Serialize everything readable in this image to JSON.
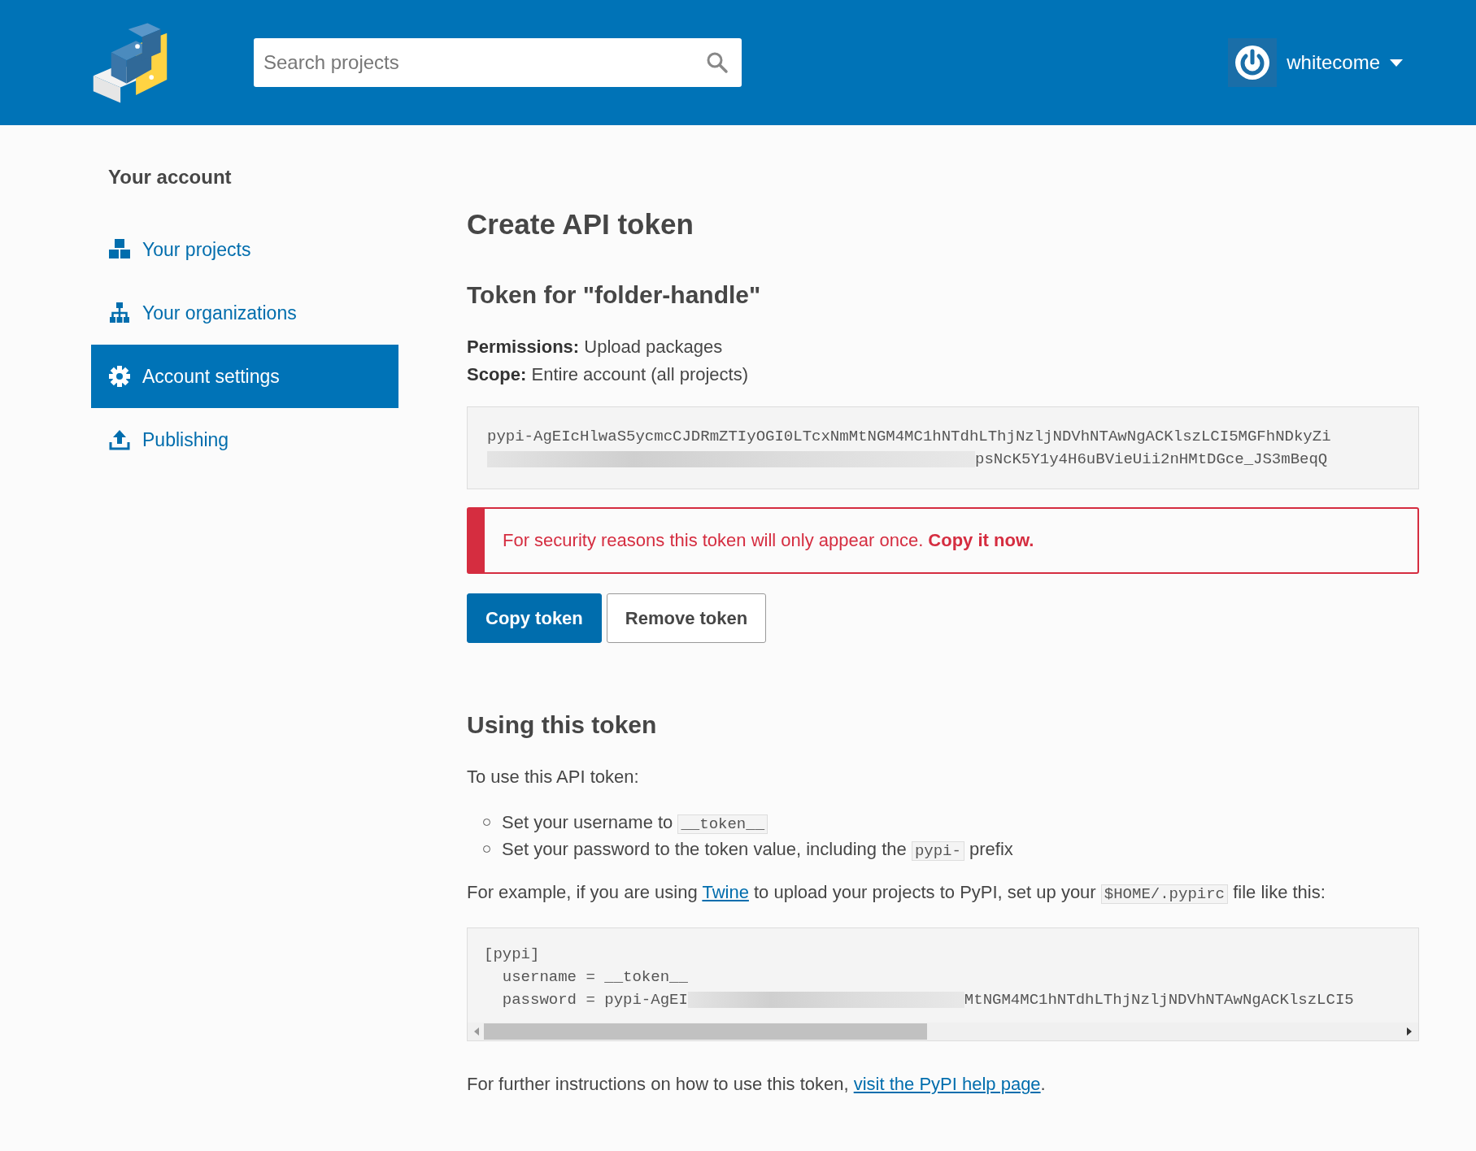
{
  "header": {
    "search": {
      "placeholder": "Search projects"
    },
    "user": {
      "name": "whitecome"
    }
  },
  "sidebar": {
    "title": "Your account",
    "items": [
      {
        "label": "Your projects",
        "selected": false
      },
      {
        "label": "Your organizations",
        "selected": false
      },
      {
        "label": "Account settings",
        "selected": true
      },
      {
        "label": "Publishing",
        "selected": false
      }
    ]
  },
  "main": {
    "title": "Create API token",
    "token_heading": "Token for \"folder-handle\"",
    "details": [
      {
        "label": "Permissions:",
        "value": "Upload packages"
      },
      {
        "label": "Scope:",
        "value": "Entire account (all projects)"
      }
    ],
    "token": {
      "line_1": "pypi-AgEIcHlwaS5ycmcCJDRmZTIyOGI0LTcxNmMtNGM4MC1hNTdhLThjNzljNDVhNTAwNgACKlszLCI5MGFhNDkyZi",
      "line_2_end": "psNcK5Y1y4H6uBVieUii2nHMtDGce_JS3mBeqQ"
    },
    "alert": {
      "text": "For security reasons this token will only appear once. **Copy it now.**"
    },
    "buttons": [
      {
        "label": "Copy token",
        "kind": "primary"
      },
      {
        "label": "Remove token",
        "kind": "secondary"
      }
    ],
    "usage": {
      "heading": "Using this token",
      "intro": "To use this API token:",
      "steps": [
        [
          {
            "text": "Set your username to "
          },
          {
            "code": "__token__"
          }
        ],
        [
          {
            "text": "Set your password to the token value, including the "
          },
          {
            "code": "pypi-"
          },
          {
            "text": " prefix"
          }
        ]
      ],
      "example": [
        {
          "text": "For example, if you are using "
        },
        {
          "link": "Twine"
        },
        {
          "text": " to upload your projects to PyPI, set up your "
        },
        {
          "code": "$HOME/.pypirc"
        },
        {
          "text": " file like this:"
        }
      ],
      "config": {
        "line_1": "[pypi]",
        "line_2": "  username = __token__",
        "line_3_start": "  password = pypi-AgEI",
        "line_3_end": "MtNGM4MC1hNTdhLThjNzljNDVhNTAwNgACKlszLCI5"
      },
      "footer": [
        {
          "text": "For further instructions on how to use this token, "
        },
        {
          "link": "visit the PyPI help page"
        },
        {
          "text": "."
        }
      ]
    }
  }
}
